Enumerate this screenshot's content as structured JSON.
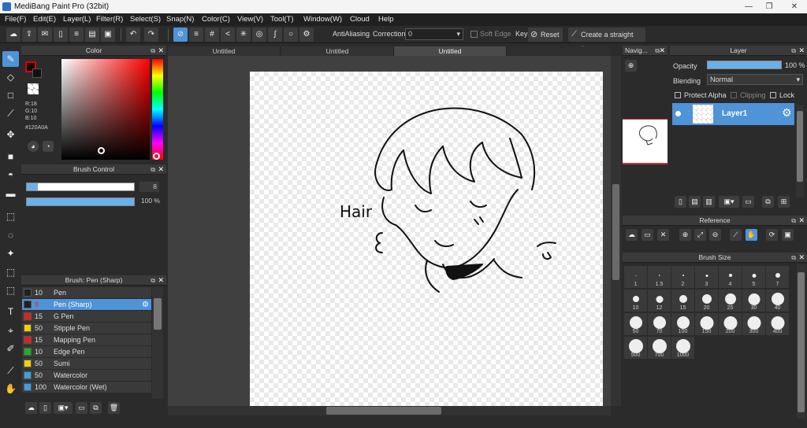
{
  "title": "MediBang Paint Pro (32bit)",
  "menu": [
    "File(F)",
    "Edit(E)",
    "Layer(L)",
    "Filter(R)",
    "Select(S)",
    "Snap(N)",
    "Color(C)",
    "View(V)",
    "Tool(T)",
    "Window(W)",
    "Cloud",
    "Help"
  ],
  "toolbar": {
    "antialiasing_label": "AntiAliasing",
    "correction_label": "Correction",
    "correction_value": "0",
    "soft_edge_label": "Soft Edge",
    "key_label": "Key",
    "reset_label": "Reset",
    "straight_line_label": "Create a straight line"
  },
  "color_panel": {
    "title": "Color",
    "r": "R:18",
    "g": "G:10",
    "b": "B:10",
    "hex": "#120A0A",
    "fg_color": "#120A0A"
  },
  "brush_control": {
    "title": "Brush Control",
    "size_value": "8",
    "opacity_value": "100 %"
  },
  "brush_panel": {
    "title": "Brush: Pen (Sharp)",
    "items": [
      {
        "num": "10",
        "name": "Pen",
        "color": "#202020"
      },
      {
        "num": "8",
        "name": "Pen (Sharp)",
        "color": "#202020"
      },
      {
        "num": "15",
        "name": "G Pen",
        "color": "#e02020"
      },
      {
        "num": "50",
        "name": "Stipple Pen",
        "color": "#f0d000"
      },
      {
        "num": "15",
        "name": "Mapping Pen",
        "color": "#e02020"
      },
      {
        "num": "10",
        "name": "Edge Pen",
        "color": "#20b020"
      },
      {
        "num": "50",
        "name": "Sumi",
        "color": "#f0d000"
      },
      {
        "num": "50",
        "name": "Watercolor",
        "color": "#3aa0e0"
      },
      {
        "num": "100",
        "name": "Watercolor (Wet)",
        "color": "#3aa0e0"
      }
    ]
  },
  "tabs": [
    "Untitled",
    "Untitled",
    "Untitled"
  ],
  "canvas_text": "Hair",
  "navigator": {
    "title": "Navig..."
  },
  "layer_panel": {
    "title": "Layer",
    "opacity_label": "Opacity",
    "opacity_value": "100 %",
    "blending_label": "Blending",
    "blending_value": "Normal",
    "protect_alpha": "Protect Alpha",
    "clipping": "Clipping",
    "lock": "Lock",
    "layer_name": "Layer1"
  },
  "reference": {
    "title": "Reference"
  },
  "brush_size": {
    "title": "Brush Size",
    "sizes": [
      "1",
      "1.5",
      "2",
      "3",
      "4",
      "5",
      "7",
      "10",
      "12",
      "15",
      "20",
      "25",
      "30",
      "40",
      "50",
      "70",
      "100",
      "150",
      "200",
      "300",
      "400",
      "500",
      "700",
      "1000"
    ]
  }
}
